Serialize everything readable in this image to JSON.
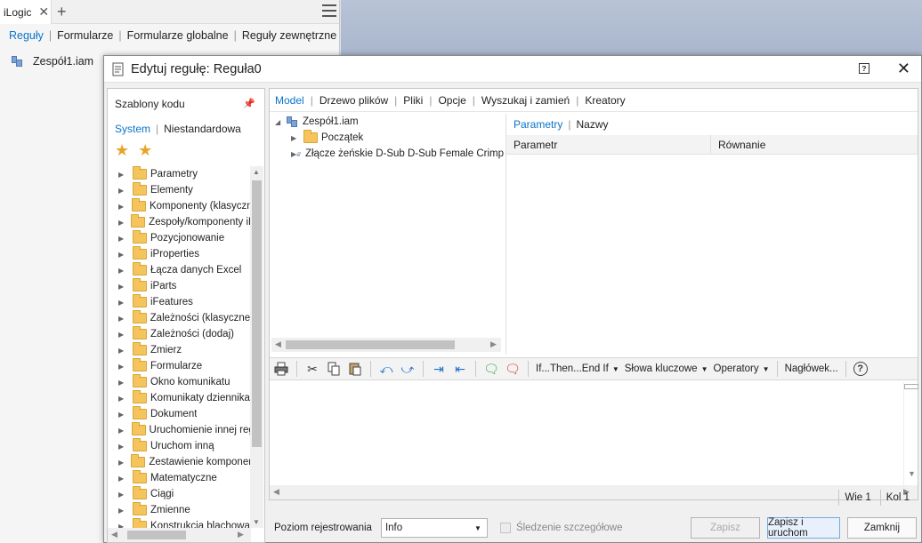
{
  "ilogic": {
    "tab_title": "iLogic",
    "tab_close": "✕",
    "add_tab": "+",
    "nav": [
      "Reguły",
      "Formularze",
      "Formularze globalne",
      "Reguły zewnętrzne"
    ],
    "tree_item": "Zespół1.iam"
  },
  "dialog": {
    "title": "Edytuj regułę: Reguła0",
    "help": "?",
    "close": "✕"
  },
  "snippets": {
    "header": "Szablony kodu",
    "tabs": [
      "System",
      "Niestandardowa"
    ],
    "items": [
      "Parametry",
      "Elementy",
      "Komponenty (klasyczne)",
      "Zespoły/komponenty iLogic",
      "Pozycjonowanie",
      "iProperties",
      "Łącza danych Excel",
      "iParts",
      "iFeatures",
      "Zależności (klasyczne)",
      "Zależności (dodaj)",
      "Zmierz",
      "Formularze",
      "Okno komunikatu",
      "Komunikaty dziennika",
      "Dokument",
      "Uruchomienie innej reguły",
      "Uruchom inną",
      "Zestawienie komponentów",
      "Matematyczne",
      "Ciągi",
      "Zmienne",
      "Konstrukcja blachowa"
    ]
  },
  "main": {
    "tabs": [
      "Model",
      "Drzewo plików",
      "Pliki",
      "Opcje",
      "Wyszukaj i zamień",
      "Kreatory"
    ],
    "tree": {
      "root": "Zespół1.iam",
      "children": [
        "Początek",
        "Złącze żeńskie D-Sub D-Sub Female Crimp"
      ]
    },
    "param_tabs": [
      "Parametry",
      "Nazwy"
    ],
    "param_columns": [
      "Parametr",
      "Równanie"
    ],
    "toolbar": {
      "if_then": "If...Then...End If",
      "keywords": "Słowa kluczowe",
      "operators": "Operatory",
      "header": "Nagłówek...",
      "help": "?"
    }
  },
  "status": {
    "line": "Wie 1",
    "col": "Kol 1"
  },
  "bottom": {
    "log_label": "Poziom rejestrowania",
    "log_value": "Info",
    "trace_label": "Śledzenie szczegółowe",
    "save": "Zapisz",
    "save_run": "Zapisz i uruchom",
    "close": "Zamknij"
  },
  "colors": {
    "accent": "#0a74c9",
    "folder": "#f5c55c",
    "star": "#e8a42a"
  }
}
